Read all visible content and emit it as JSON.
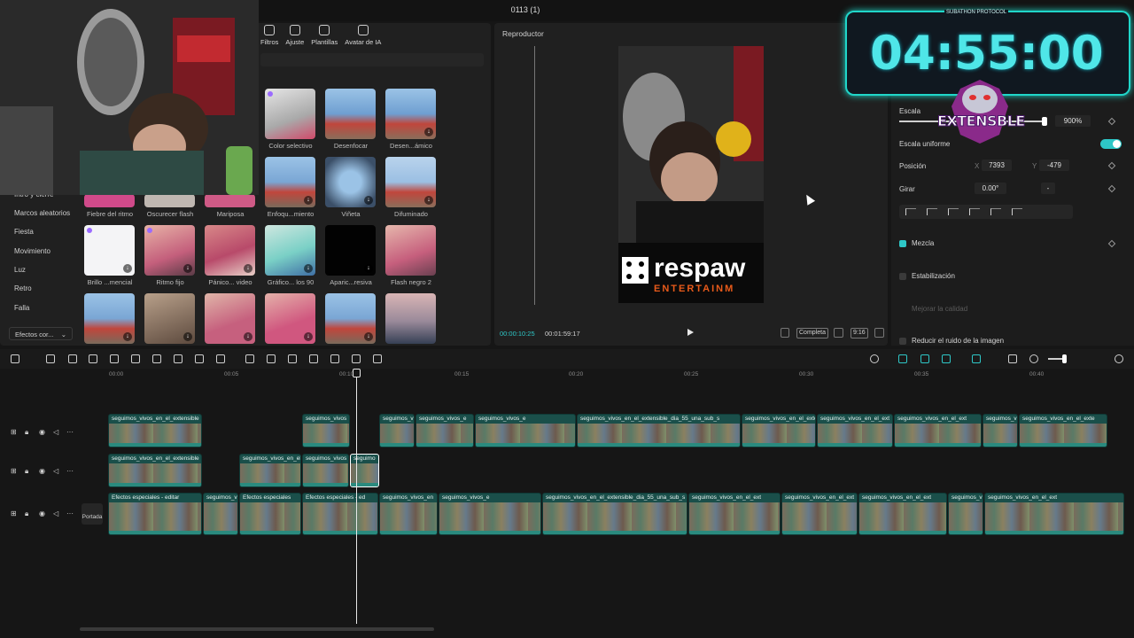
{
  "window": {
    "title": "0113 (1)"
  },
  "categories": [
    {
      "label": "Filtros",
      "icon": "filters-icon"
    },
    {
      "label": "Ajuste",
      "icon": "adjust-icon"
    },
    {
      "label": "Plantillas",
      "icon": "templates-icon"
    },
    {
      "label": "Avatar de IA",
      "icon": "ai-avatar-icon"
    }
  ],
  "sidebar": {
    "items": [
      "Intro y cierre",
      "Marcos aleatorios",
      "Fiesta",
      "Movimiento",
      "Luz",
      "Retro",
      "Falla"
    ],
    "dropdown": "Efectos cor..."
  },
  "effects": {
    "row1": [
      "Color selectivo",
      "Desenfocar",
      "Desen...ámico"
    ],
    "row2": [
      "Enfoqu...miento",
      "Viñeta",
      "Difuminado"
    ],
    "row3": [
      "Fiebre del ritmo",
      "Oscurecer flash",
      "Mariposa"
    ],
    "row4": [
      "Brillo ...mencial",
      "Ritmo fijo",
      "Pánico... video",
      "Gráfico... los 90",
      "Aparic...resiva",
      "Flash negro 2"
    ]
  },
  "player": {
    "title": "Reproductor",
    "current_time": "00:00:10:25",
    "total_time": "00:01:59:17",
    "fit_label": "Completa",
    "ratio_label": "9:16",
    "preview_overlay_line1": "respaw",
    "preview_overlay_line2": "ENTERTAINM"
  },
  "inspector": {
    "scale_label": "Escala",
    "scale_value": "900%",
    "uniform_scale_label": "Escala uniforme",
    "uniform_scale_on": true,
    "position_label": "Posición",
    "pos_x_label": "X",
    "pos_x": "7393",
    "pos_y_label": "Y",
    "pos_y": "-479",
    "rotate_label": "Girar",
    "rotate_value": "0.00°",
    "rotate_reset": "-",
    "blend_label": "Mezcla",
    "stabilize_label": "Estabilización",
    "enhance_label": "Mejorar la calidad",
    "denoise_label": "Reducir el ruido de la imagen"
  },
  "overlay": {
    "timer": "04:55:00",
    "timer_caption": "SUBATHON PROTOCOL",
    "brand": "EXTENSBLE",
    "accent": "#20d6c9"
  },
  "timeline": {
    "ruler": [
      "00:00",
      "00:05",
      "00:10",
      "00:15",
      "00:20",
      "00:25",
      "00:30",
      "00:35",
      "00:40"
    ],
    "cover_label": "Portada",
    "track1_clips": [
      {
        "name": "seguimos_vivos_en_el_extensible"
      },
      {
        "name": "seguimos_vivos"
      },
      {
        "name": "seguimos_v"
      },
      {
        "name": "seguimos_vivos_e"
      },
      {
        "name": "seguimos_vivos_e"
      },
      {
        "name": "seguimos_vivos_en_el_extensible_dia_55_una_sub_s"
      },
      {
        "name": "seguimos_vivos_en_el_exte"
      },
      {
        "name": "seguimos_vivos_en_el_ext"
      },
      {
        "name": "seguimos_vivos_en_el_ext"
      },
      {
        "name": "seguimos_vi"
      },
      {
        "name": "seguimos_vivos_en_el_exte"
      }
    ],
    "track2_clips": [
      {
        "name": "seguimos_vivos_en_el_extensible"
      },
      {
        "name": "seguimos_vivos_en_el"
      },
      {
        "name": "seguimos_vivos"
      },
      {
        "name": "seguimo"
      }
    ],
    "track3_clips": [
      {
        "name": "Efectos especiales - editar"
      },
      {
        "name": "seguimos_vi"
      },
      {
        "name": "Efectos especiales"
      },
      {
        "name": "Efectos especiales - ed"
      },
      {
        "name": "seguimos_vivos_en"
      },
      {
        "name": "seguimos_vivos_e"
      },
      {
        "name": "seguimos_vivos_en_el_extensible_dia_55_una_sub_s"
      },
      {
        "name": "seguimos_vivos_en_el_ext"
      },
      {
        "name": "seguimos_vivos_en_el_ext"
      },
      {
        "name": "seguimos_vivos_en_el_ext"
      },
      {
        "name": "seguimos_v"
      },
      {
        "name": "seguimos_vivos_en_el_ext"
      }
    ]
  }
}
